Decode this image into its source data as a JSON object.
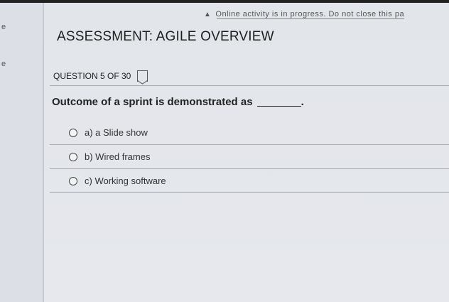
{
  "banner": {
    "text": "Online activity is in progress. Do not close this pa"
  },
  "left_strip": {
    "chevron_top": "e",
    "chevron_bottom": "e"
  },
  "assessment": {
    "title": "ASSESSMENT: AGILE OVERVIEW"
  },
  "question": {
    "counter": "QUESTION 5 OF 30",
    "text": "Outcome of a sprint is demonstrated as",
    "suffix": ".",
    "options": [
      {
        "label": "a) a Slide show"
      },
      {
        "label": "b) Wired frames"
      },
      {
        "label": "c) Working software"
      }
    ]
  }
}
